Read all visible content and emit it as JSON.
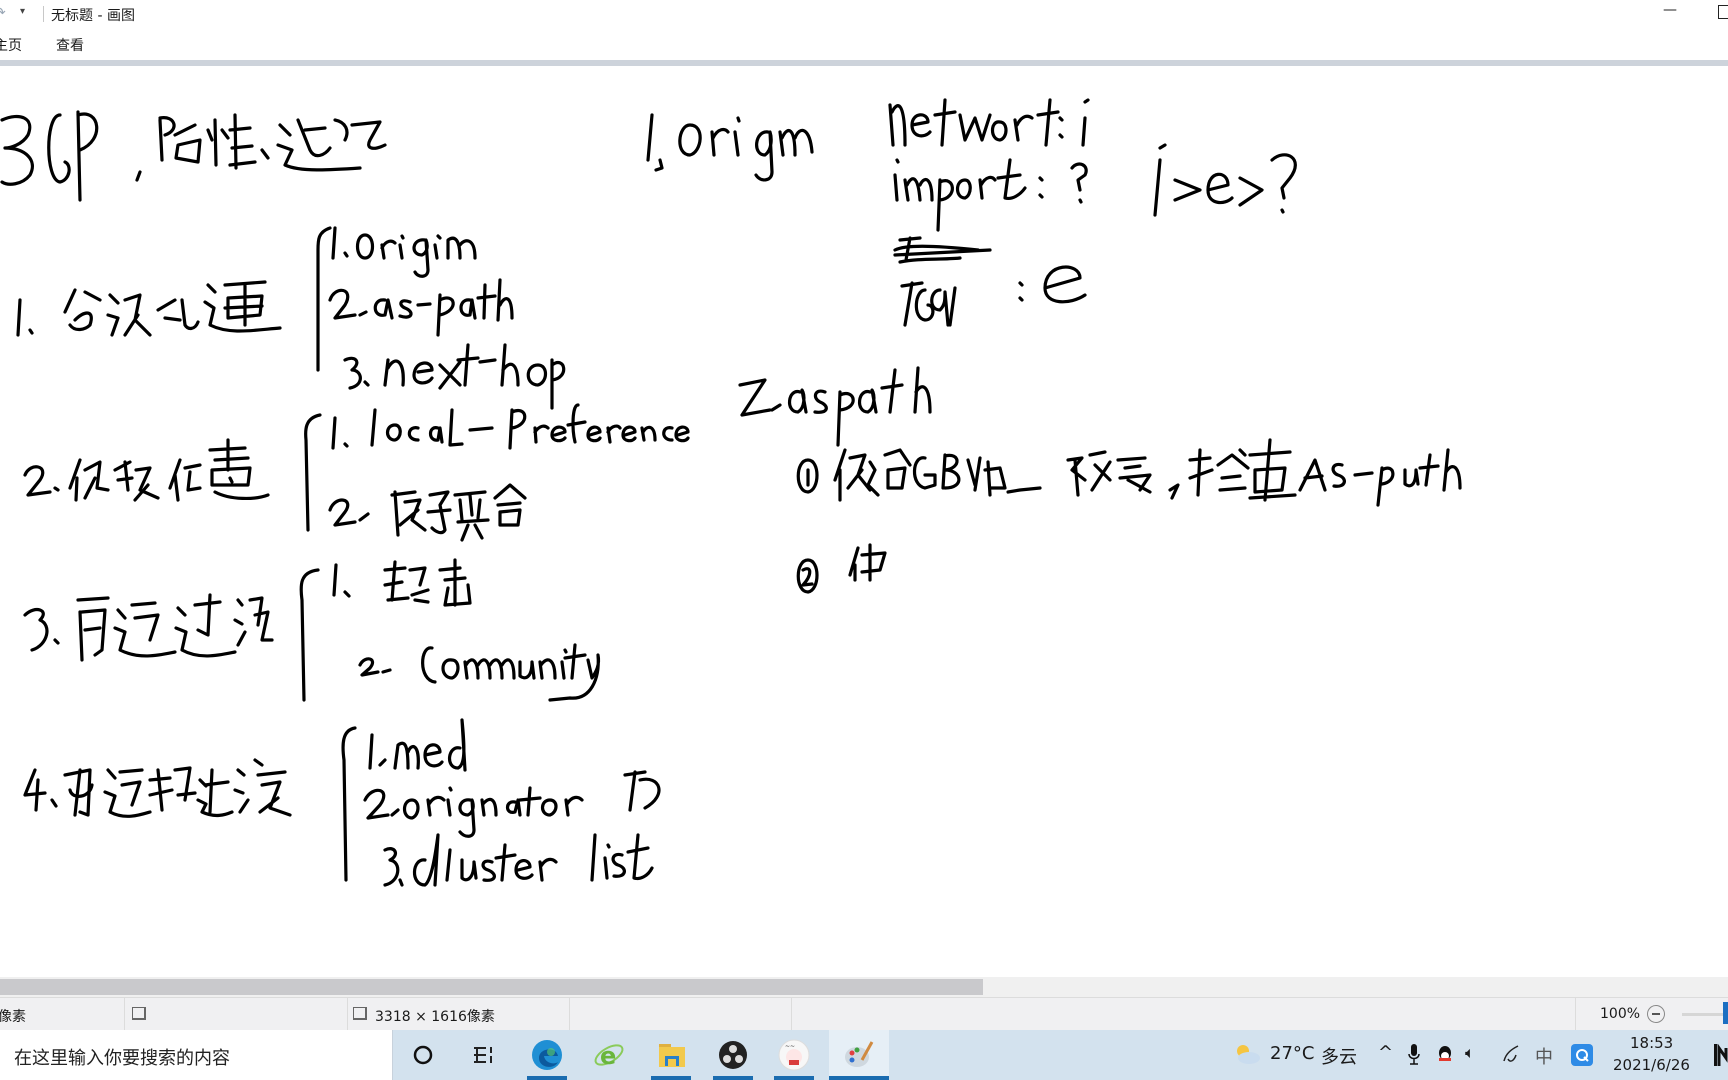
{
  "window": {
    "title": "无标题 - 画图",
    "quick_access_dropdown": "▾",
    "minimize_glyph": "—"
  },
  "ribbon": {
    "tabs": [
      {
        "label": "主页"
      },
      {
        "label": "查看"
      }
    ]
  },
  "canvas": {
    "accent_ink": "#000000",
    "notes": {
      "title": "BGP，属性，选路",
      "categories": [
        {
          "label": "1. 公认必遵",
          "items": [
            "1. origin",
            "2. as-path",
            "3. next-hop"
          ]
        },
        {
          "label": "2. 公认任意",
          "items": [
            "1. local-Preference",
            "2. 原子聚合"
          ]
        },
        {
          "label": "3. 可选过渡",
          "items": [
            "1. 聚合者",
            "2. community"
          ]
        },
        {
          "label": "4. 可选非过渡",
          "items": [
            "1. med",
            "2. originator ID",
            "3. cluster list"
          ]
        }
      ],
      "origin_section": {
        "heading": "1. origin",
        "rows": [
          {
            "key": "network",
            "value": "i"
          },
          {
            "key": "import",
            "value": "?"
          },
          {
            "key": "EGP (struck-through)",
            "value": ""
          },
          {
            "key": "EGP",
            "value": "e"
          }
        ],
        "preference": "i > e > ?"
      },
      "aspath_section": {
        "heading": "2. aspath",
        "points": [
          "① 传给EBGP，改变，检查AS-path",
          "② 传"
        ]
      }
    }
  },
  "statusbar": {
    "position_text": "像素",
    "canvas_size": "3318 × 1616像素",
    "zoom_level": "100%",
    "zoom_slider_fraction": 0.5
  },
  "taskbar": {
    "search_placeholder": "在这里输入你要搜索的内容",
    "apps": [
      {
        "name": "cortana",
        "icon": "circle-icon"
      },
      {
        "name": "task-view",
        "icon": "task-view-icon"
      },
      {
        "name": "edge",
        "icon": "edge-icon",
        "active": true
      },
      {
        "name": "ie-browser",
        "icon": "ie-icon"
      },
      {
        "name": "file-explorer",
        "icon": "folder-icon",
        "active": true
      },
      {
        "name": "obs",
        "icon": "obs-icon",
        "active": true
      },
      {
        "name": "chat-app",
        "icon": "avatar-icon",
        "active": true
      },
      {
        "name": "paint",
        "icon": "paint-palette-icon",
        "active": true
      }
    ],
    "weather": {
      "temp": "27°C",
      "condition": "多云"
    },
    "ime": "中",
    "clock": {
      "time": "18:53",
      "date": "2021/6/26"
    }
  }
}
